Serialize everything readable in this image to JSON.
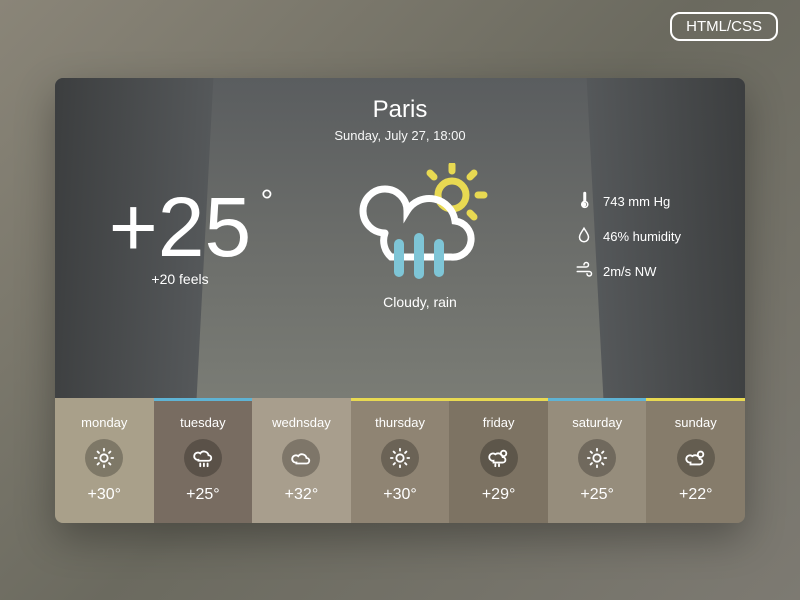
{
  "badge": "HTML/CSS",
  "header": {
    "city": "Paris",
    "date": "Sunday, July 27, 18:00"
  },
  "current": {
    "temp": "+25",
    "feels": "+20 feels",
    "condition": "Cloudy, rain",
    "icon": "cloud-rain-sun"
  },
  "details": {
    "pressure": "743 mm Hg",
    "humidity": "46% humidity",
    "wind": "2m/s NW"
  },
  "forecast": [
    {
      "day": "monday",
      "temp": "+30°",
      "icon": "sun",
      "accent": "#a9a08a"
    },
    {
      "day": "tuesday",
      "temp": "+25°",
      "icon": "cloud-rain",
      "accent": "#5fb3d4"
    },
    {
      "day": "wednsday",
      "temp": "+32°",
      "icon": "cloud",
      "accent": "#a89e8d"
    },
    {
      "day": "thursday",
      "temp": "+30°",
      "icon": "sun",
      "accent": "#e8d952"
    },
    {
      "day": "friday",
      "temp": "+29°",
      "icon": "cloud-rain-sun",
      "accent": "#e8d952"
    },
    {
      "day": "saturday",
      "temp": "+25°",
      "icon": "sun",
      "accent": "#5fb3d4"
    },
    {
      "day": "sunday",
      "temp": "+22°",
      "icon": "cloud-sun",
      "accent": "#e8d952"
    }
  ]
}
